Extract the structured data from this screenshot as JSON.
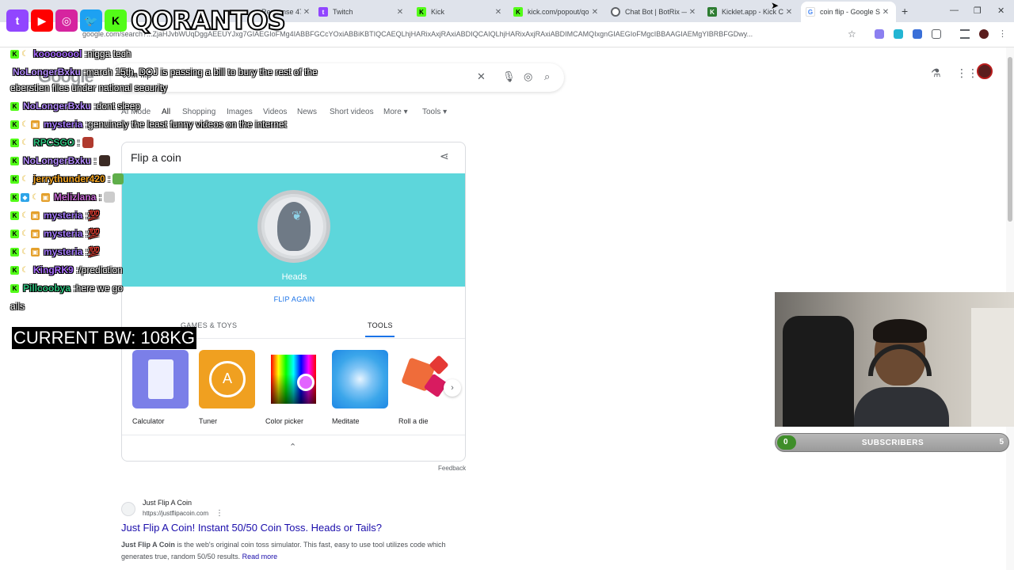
{
  "browser": {
    "tabs": [
      {
        "label": "Response 47 o",
        "icon": "generic",
        "color": "#8e8e8e"
      },
      {
        "label": "Twitch",
        "icon": "twitch",
        "color": "#9146ff"
      },
      {
        "label": "Kick",
        "icon": "kick",
        "color": "#53fc18"
      },
      {
        "label": "kick.com/popout/qo",
        "icon": "kick",
        "color": "#53fc18"
      },
      {
        "label": "Chat Bot | BotRix — C",
        "icon": "botrix",
        "color": "#5f6368"
      },
      {
        "label": "Kicklet.app - Kick Ch",
        "icon": "kicklet",
        "color": "#2e7d32"
      },
      {
        "label": "coin flip - Google Sea",
        "icon": "google",
        "color": "#4285f4"
      }
    ],
    "url": "google.com/search?...ZjaHJvbWUqDggAEEUYJxg7GIAEGIoFMg4IABBFGCcYOxiABBiKBTIQCAEQLhjHARixAxjRAxiABDIQCAIQLhjHARixAxjRAxiABDIMCAMQIxgnGIAEGIoFMgcIBBAAGIAEMgYIBRBFGDwy...",
    "new_tab_glyph": "+",
    "window_controls": [
      "—",
      "❐",
      "✕"
    ]
  },
  "google": {
    "logo_text": "Google",
    "query": "coin flip",
    "nav_tabs": [
      "AI Mode",
      "All",
      "Shopping",
      "Images",
      "Videos",
      "News",
      "Short videos",
      "More",
      "Tools"
    ],
    "active_tab": "All"
  },
  "coin_card": {
    "title": "Flip a coin",
    "result": "Heads",
    "flip_again": "FLIP AGAIN",
    "section_tabs": [
      "GAMES & TOYS",
      "TOOLS"
    ],
    "active_section": "TOOLS",
    "coin_bg": "#5dd6db",
    "tools": [
      {
        "label": "Calculator",
        "color": "#7b7fe8"
      },
      {
        "label": "Tuner",
        "color": "#f0a020"
      },
      {
        "label": "Color picker",
        "color": "#ffffff"
      },
      {
        "label": "Meditate",
        "color": "#3ba6ea"
      },
      {
        "label": "Roll a die",
        "color": "#ffffff"
      }
    ],
    "feedback": "Feedback"
  },
  "result": {
    "site_name": "Just Flip A Coin",
    "url": "https://justflipacoin.com",
    "title": "Just Flip A Coin! Instant 50/50 Coin Toss. Heads or Tails?",
    "snippet_bold": "Just Flip A Coin",
    "snippet": " is the web's original coin toss simulator. This fast, easy to use tool utilizes code which generates true, random 50/50 results.",
    "read_more": "Read more"
  },
  "overlay": {
    "brand": "QORANTOS",
    "chat": [
      {
        "badges": [
          "k",
          "moon"
        ],
        "user": "koooooool",
        "color": "#a86bff",
        "message": "nigga tech"
      },
      {
        "badges": [],
        "user": "NoLongerBxku",
        "color": "#b58cff",
        "message": "march 15th, DOJ is passing a bill to bury the rest of the"
      },
      {
        "badges": [],
        "user": "",
        "color": "#ffffff",
        "message": "eberstien files under national security"
      },
      {
        "badges": [
          "k"
        ],
        "user": "NoLongerBxku",
        "color": "#b58cff",
        "message": "dont sleep"
      },
      {
        "badges": [
          "k",
          "moon",
          "gift"
        ],
        "user": "mysteria",
        "color": "#a67bff",
        "message": "genuinely the least funny videos on the internet"
      },
      {
        "badges": [
          "k",
          "moon"
        ],
        "user": "RPCSGO",
        "color": "#2ec27e",
        "message": "",
        "emote": "#b03a2e"
      },
      {
        "badges": [
          "k"
        ],
        "user": "NoLongerBxku",
        "color": "#b58cff",
        "message": "",
        "emote": "#3b2a24"
      },
      {
        "badges": [
          "k",
          "moon"
        ],
        "user": "jerrythunder420",
        "color": "#f5a623",
        "message": "",
        "emote": "#5fae4a"
      },
      {
        "badges": [
          "k",
          "blue",
          "moon",
          "gift"
        ],
        "user": "Melizlana",
        "color": "#c86bd6",
        "message": "",
        "emote": "#cccccc"
      },
      {
        "badges": [
          "k",
          "moon",
          "gift"
        ],
        "user": "mysteria",
        "color": "#a67bff",
        "message": "💯"
      },
      {
        "badges": [
          "k",
          "moon",
          "gift"
        ],
        "user": "mysteria",
        "color": "#a67bff",
        "message": "💯"
      },
      {
        "badges": [
          "k",
          "moon",
          "gift"
        ],
        "user": "mysteria",
        "color": "#a67bff",
        "message": "💯"
      },
      {
        "badges": [
          "k",
          "moon"
        ],
        "user": "KingRK9",
        "color": "#a86bff",
        "message": "/prediction"
      },
      {
        "badges": [
          "k"
        ],
        "user": "Pillcoobya",
        "color": "#2ec27e",
        "message": "here we go"
      },
      {
        "badges": [],
        "user": "",
        "color": "#ffffff",
        "message": "ails"
      }
    ],
    "bw": "CURRENT BW: 108KG",
    "subs": {
      "current": "0",
      "label": "SUBSCRIBERS",
      "goal": "5",
      "fill_fraction": 0.0
    }
  }
}
